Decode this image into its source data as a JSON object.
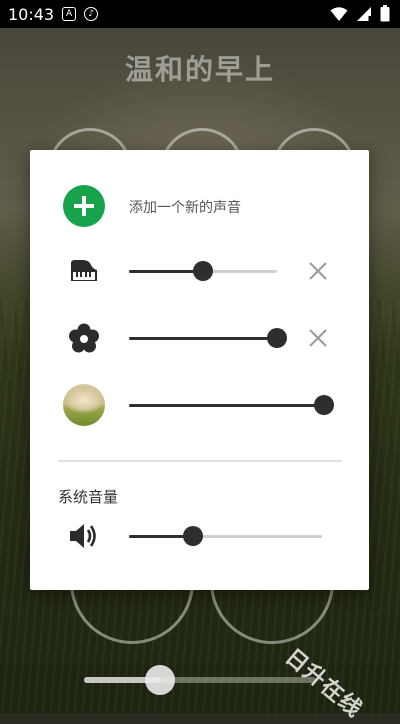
{
  "status_bar": {
    "time": "10:43",
    "icons": [
      "text-a-icon",
      "music-icon",
      "wifi-icon",
      "signal-icon",
      "battery-icon"
    ]
  },
  "background": {
    "title": "温和的早上",
    "progress_fraction": 0.33
  },
  "dialog": {
    "add_sound_label": "添加一个新的声音",
    "sounds": [
      {
        "icon": "piano-icon",
        "volume": 0.5,
        "removable": true
      },
      {
        "icon": "flower-icon",
        "volume": 1.0,
        "removable": true
      },
      {
        "icon": "scene-thumbnail",
        "volume": 1.0,
        "removable": false
      }
    ],
    "system_volume_label": "系统音量",
    "system_volume": 0.33
  },
  "watermark": "日升在线",
  "colors": {
    "accent_green": "#17a24b",
    "slider_dark": "#2e2e2e",
    "slider_track": "#cfcfcf"
  }
}
